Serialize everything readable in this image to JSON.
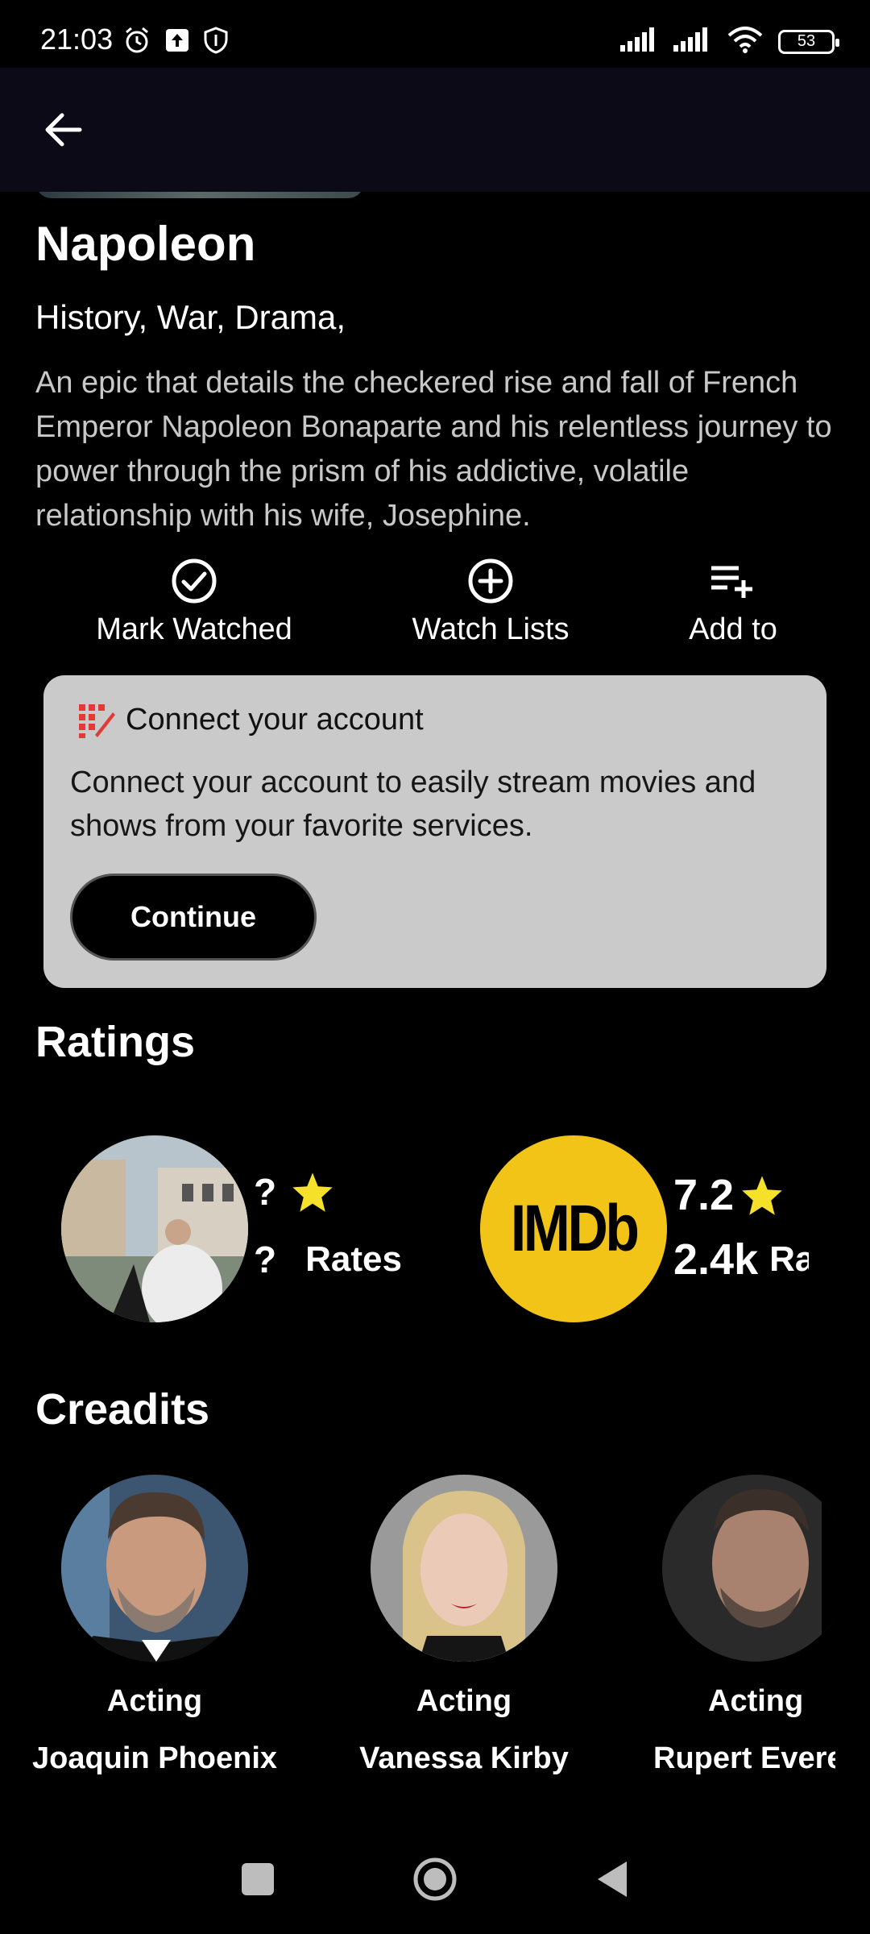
{
  "status_bar": {
    "time": "21:03",
    "battery": "53",
    "icons": [
      "alarm-icon",
      "upload-icon",
      "shield-icon",
      "signal-icon",
      "signal-icon",
      "wifi-icon",
      "battery-icon"
    ]
  },
  "app_bar": {
    "back_icon": "arrow-left-icon"
  },
  "movie": {
    "title": "Napoleon",
    "genres": "History, War, Drama,",
    "overview": "An epic that details the checkered rise and fall of French Emperor Napoleon Bonaparte and his relentless journey to power through the prism of his addictive, volatile relationship with his wife, Josephine."
  },
  "actions": [
    {
      "label": "Mark Watched",
      "icon": "check-circle-icon"
    },
    {
      "label": "Watch Lists",
      "icon": "plus-circle-icon"
    },
    {
      "label": "Add to",
      "icon": "playlist-add-icon"
    }
  ],
  "connect": {
    "title": "Connect your account",
    "text": "Connect your account to easily stream movies and shows from your favorite services.",
    "button": "Continue",
    "colors": {
      "logo": "#e53935",
      "card": "#cacaca"
    }
  },
  "ratings": {
    "title": "Ratings",
    "items": [
      {
        "score": "?",
        "count": "?",
        "count_label": "Rates"
      },
      {
        "logo_text": "IMDb",
        "score": "7.2",
        "count": "2.4k",
        "count_label": "Ra"
      }
    ],
    "colors": {
      "star": "#f5e02a",
      "imdb": "#f2c418"
    }
  },
  "credits": {
    "title": "Creadits",
    "items": [
      {
        "role": "Acting",
        "name": "Joaquin Phoenix"
      },
      {
        "role": "Acting",
        "name": "Vanessa Kirby"
      },
      {
        "role": "Acting",
        "name": "Rupert Evere"
      }
    ]
  },
  "nav_bar": {
    "icons": [
      "recents-square-icon",
      "home-circle-icon",
      "back-triangle-icon"
    ]
  }
}
